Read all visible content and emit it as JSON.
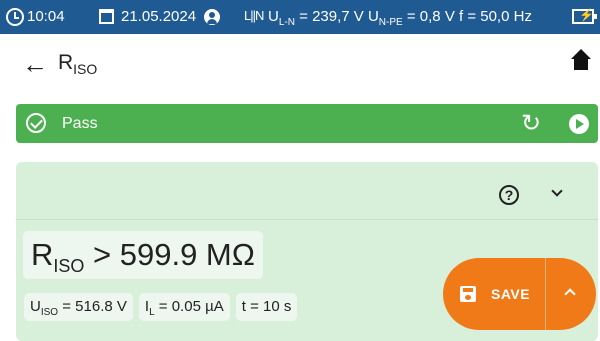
{
  "statusbar": {
    "clock_icon": "clock-icon",
    "time": "10:04",
    "calendar_icon": "calendar-icon",
    "date": "21.05.2024",
    "user_icon": "person-icon",
    "socket_icon": "socket-icon",
    "socket_text": "L||N",
    "uln_label": "U",
    "uln_sub": "L-N",
    "uln_value": " = 239,7 V ",
    "unpe_label": "U",
    "unpe_sub": "N-PE",
    "unpe_value": " = 0,8 V f = 50,0 Hz",
    "battery_icon": "battery-charging-icon",
    "bg_color": "#1f5a93"
  },
  "header": {
    "back_icon": "arrow-left-icon",
    "back_glyph": "←",
    "title": "R",
    "title_sub": "ISO",
    "home_icon": "home-icon"
  },
  "passbar": {
    "check_icon": "check-circle-icon",
    "label": "Pass",
    "retry_icon": "retry-icon",
    "retry_glyph": "↻",
    "play_icon": "play-circle-icon",
    "color": "#4caf50"
  },
  "panel": {
    "help_icon": "help-icon",
    "help_glyph": "?",
    "collapse_icon": "chevron-down-icon",
    "result": {
      "symbol": "R",
      "symbol_sub": "ISO",
      "value": " > 599.9 MΩ"
    },
    "chips": [
      {
        "label": "U",
        "sub": "ISO",
        "value": " = 516.8 V"
      },
      {
        "label": "I",
        "sub": "L",
        "value": " = 0.05 µA"
      },
      {
        "label": "",
        "sub": "",
        "value": "t = 10 s"
      }
    ],
    "bg_color": "#d8efd9"
  },
  "save_button": {
    "icon": "floppy-disk-icon",
    "label": "SAVE",
    "expand_icon": "chevron-up-icon",
    "color": "#f07a18"
  }
}
